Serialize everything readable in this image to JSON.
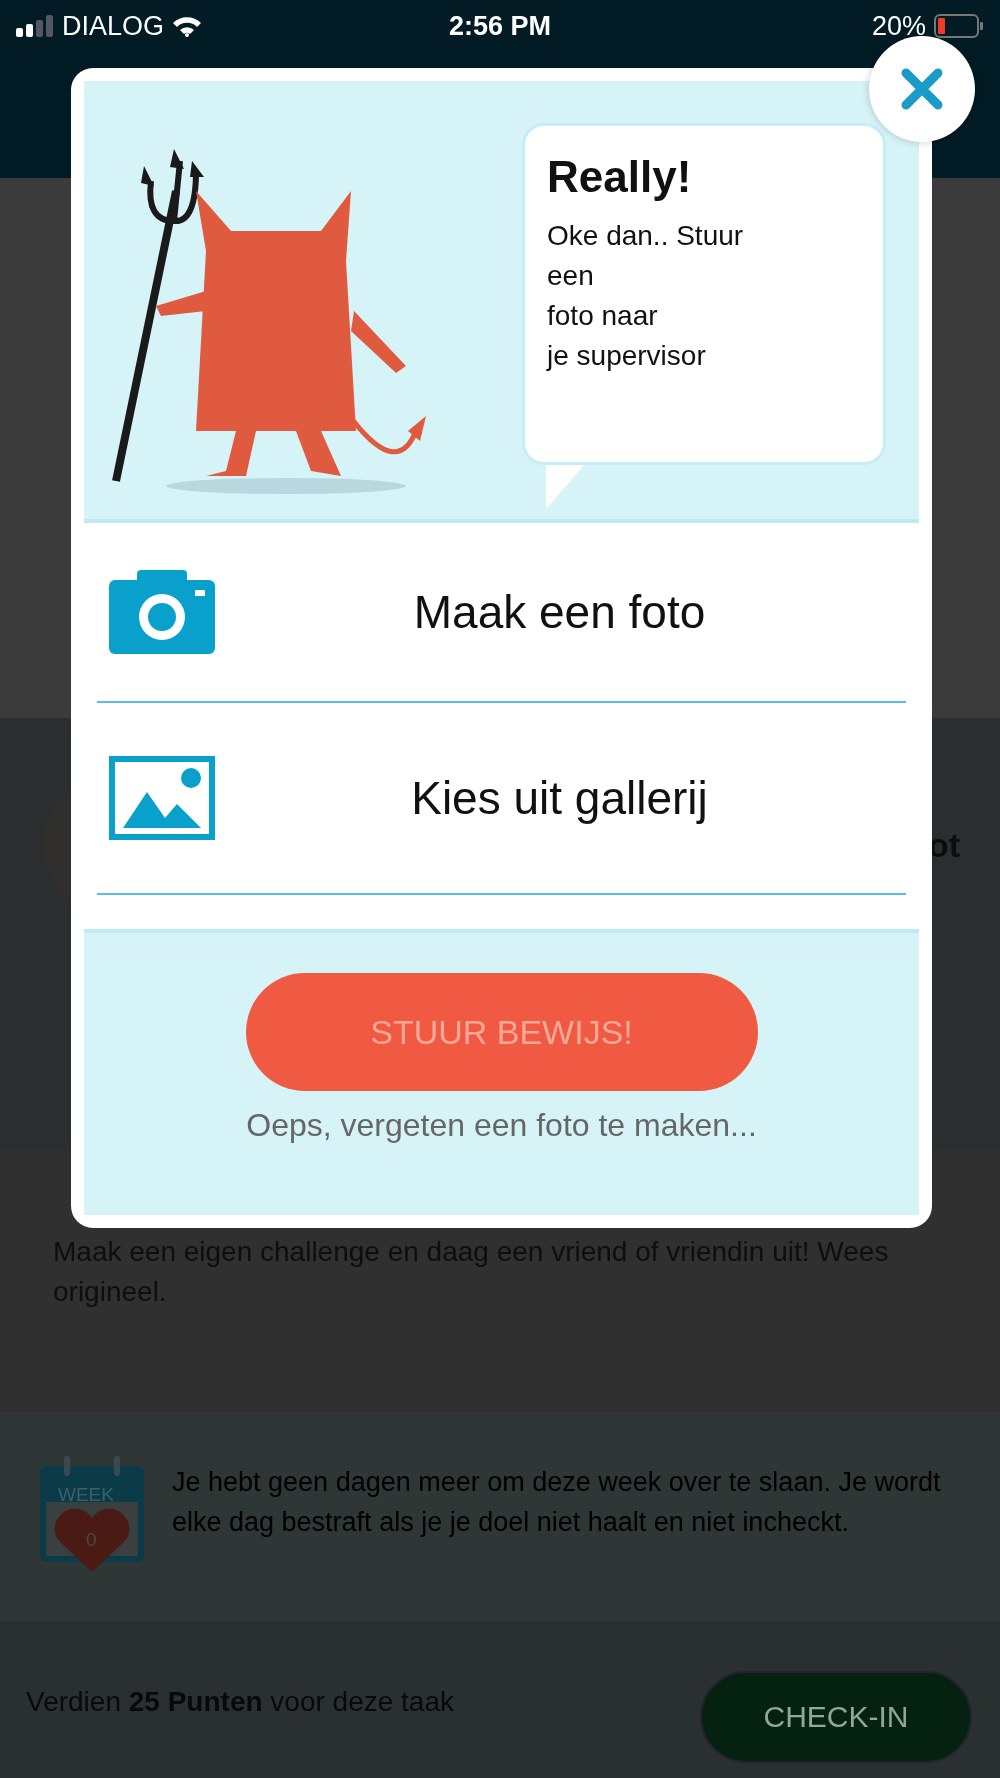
{
  "status_bar": {
    "carrier": "DIALOG",
    "time": "2:56 PM",
    "battery": "20%"
  },
  "background": {
    "fragment": "ot",
    "description": "Maak een eigen challenge en daag een vriend of vriendin uit! Wees origineel.",
    "week_notice": {
      "badge_label": "WEEK",
      "count": "0",
      "text": "Je hebt geen dagen meer om deze week over te slaan. Je wordt elke dag bestraft als je je doel niet haalt en niet incheckt."
    },
    "reward": "Verdien **25 Punten** voor deze taak",
    "checkin_button": "CHECK-IN"
  },
  "modal": {
    "bubble": {
      "title": "Really!",
      "text": "Oke dan.. Stuur\neen\nfoto naar\nje supervisor"
    },
    "options": [
      {
        "kind": "camera",
        "label": "Maak een foto"
      },
      {
        "kind": "gallery",
        "label": "Kies uit gallerij"
      }
    ],
    "submit_button": "STUUR BEWIJS!",
    "hint": "Oeps, vergeten een foto te maken..."
  }
}
